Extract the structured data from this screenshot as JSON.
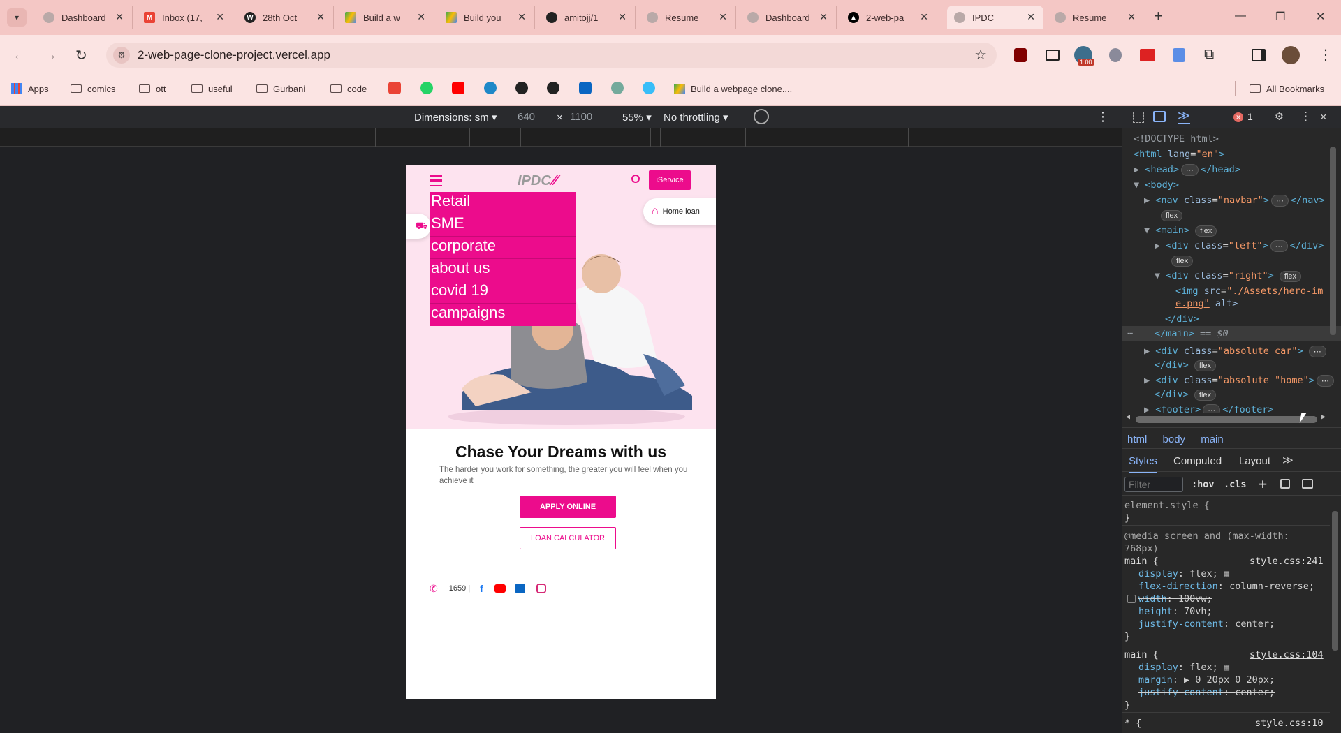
{
  "browser": {
    "tabs": [
      {
        "title": "Dashboard",
        "icon": "globe-icon"
      },
      {
        "title": "Inbox (17,",
        "icon": "gmail-icon"
      },
      {
        "title": "28th Oct",
        "icon": "wordpress-icon"
      },
      {
        "title": "Build a w",
        "icon": "google-drive-icon"
      },
      {
        "title": "Build you",
        "icon": "google-drive-icon"
      },
      {
        "title": "amitojj/1",
        "icon": "github-icon"
      },
      {
        "title": "Resume",
        "icon": "globe-icon"
      },
      {
        "title": "Dashboard",
        "icon": "globe-icon"
      },
      {
        "title": "2-web-pa",
        "icon": "vercel-icon"
      },
      {
        "title": "IPDC",
        "icon": "globe-icon",
        "active": true
      },
      {
        "title": "Resume",
        "icon": "globe-icon"
      }
    ],
    "url": "2-web-page-clone-project.vercel.app",
    "extension_badge": "1.00",
    "bookmarks": [
      {
        "label": "Apps",
        "type": "apps"
      },
      {
        "label": "comics",
        "type": "folder"
      },
      {
        "label": "ott",
        "type": "folder"
      },
      {
        "label": "useful",
        "type": "folder"
      },
      {
        "label": "Gurbani",
        "type": "folder"
      },
      {
        "label": "code",
        "type": "folder"
      },
      {
        "label": "Build a webpage clone....",
        "type": "link"
      }
    ],
    "all_bookmarks": "All Bookmarks",
    "colors": {
      "tab_strip": "#f4c7c5",
      "toolbar": "#fbe4e3"
    }
  },
  "device_toolbar": {
    "dimensions_label": "Dimensions: sm",
    "width": "640",
    "times": "×",
    "height": "1100",
    "zoom": "55%",
    "throttling": "No throttling"
  },
  "site": {
    "logo": "IPDC",
    "iservice": "iService",
    "menu": [
      "Retail",
      "SME",
      "corporate",
      "about us",
      "covid 19",
      "campaigns"
    ],
    "home_loan": "Home loan",
    "heading": "Chase Your Dreams with us",
    "tagline": "The harder you work for something, the greater you will feel when you achieve it",
    "apply_btn": "APPLY ONLINE",
    "calc_btn": "LOAN CALCULATOR",
    "phone": "1659 |",
    "colors": {
      "brand": "#ec0c8c",
      "hero_bg": "#fde3ef"
    }
  },
  "devtools": {
    "error_count": "1",
    "dom": {
      "doctype": "<!DOCTYPE html>",
      "html_open": "<html",
      "lang_attr": "lang",
      "lang_val": "\"en\"",
      "head": "<head>",
      "head_close": "</head>",
      "body": "<body>",
      "nav": "<nav",
      "class": "class",
      "navbar_val": "\"navbar\"",
      "nav_close": "</nav>",
      "main": "<main>",
      "div": "<div",
      "left_val": "\"left\"",
      "div_close": "</div>",
      "right_val": "\"right\"",
      "img": "<img",
      "src": "src",
      "src_val1": "\"./Assets/hero-im",
      "src_val2": "e.png\"",
      "alt": "alt>",
      "main_close": "</main>",
      "eq": "== $0",
      "car_val": "\"absolute car\"",
      "home_val": "\"home\"",
      "absolute_word": "\"absolute",
      "footer": "<footer>",
      "footer_close": "</footer>",
      "flex": "flex",
      "ellipsis": "⋯"
    },
    "breadcrumb": [
      "html",
      "body",
      "main"
    ],
    "panel_tabs": [
      "Styles",
      "Computed",
      "Layout"
    ],
    "filter_placeholder": "Filter",
    "hov": ":hov",
    "cls": ".cls",
    "styles": {
      "element_style": "element.style {",
      "close": "}",
      "media": "@media screen and (max-width:",
      "media2": "768px)",
      "main_sel": "main {",
      "src1": "style.css:241",
      "src2": "style.css:104",
      "src3": "style.css:10",
      "rule1": [
        {
          "prop": "display",
          "val": "flex;"
        },
        {
          "prop": "flex-direction",
          "val": "column-reverse;"
        },
        {
          "prop": "width",
          "val": "100vw;",
          "struck": true
        },
        {
          "prop": "height",
          "val": "70vh;"
        },
        {
          "prop": "justify-content",
          "val": "center;"
        }
      ],
      "rule2": [
        {
          "prop": "display",
          "val": "flex;",
          "struck": true
        },
        {
          "prop": "margin",
          "val": "▶ 0 20px 0 20px;"
        },
        {
          "prop": "justify-content",
          "val": "center;",
          "struck": true
        }
      ],
      "star": "* {"
    }
  }
}
